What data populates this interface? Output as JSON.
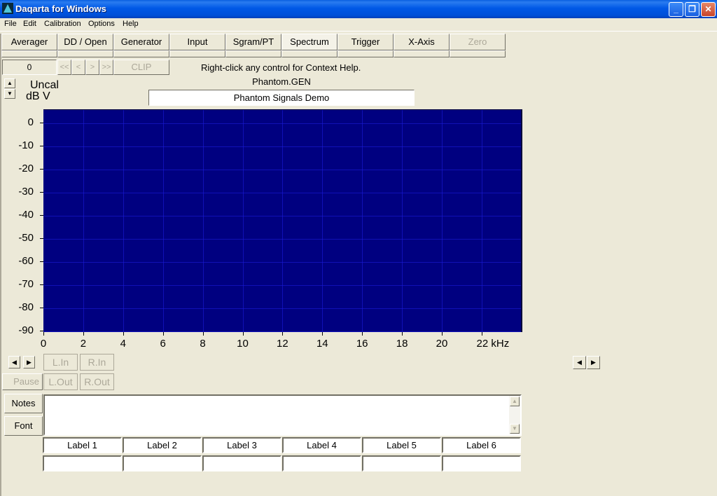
{
  "window": {
    "title": "Daqarta for Windows",
    "controls": {
      "minimize": "_",
      "restore": "❐",
      "close": "✕"
    }
  },
  "menu": [
    "File",
    "Edit",
    "Calibration",
    "Options",
    "Help"
  ],
  "tabs": [
    {
      "label": "Averager",
      "state": "normal"
    },
    {
      "label": "DD / Open",
      "state": "normal"
    },
    {
      "label": "Generator",
      "state": "normal"
    },
    {
      "label": "Input",
      "state": "normal"
    },
    {
      "label": "Sgram/PT",
      "state": "normal"
    },
    {
      "label": "Spectrum",
      "state": "active"
    },
    {
      "label": "Trigger",
      "state": "normal"
    },
    {
      "label": "X-Axis",
      "state": "normal"
    },
    {
      "label": "Zero",
      "state": "disabled"
    }
  ],
  "toolbar": {
    "frame_value": "0",
    "nav": [
      "<<",
      "<",
      ">",
      ">>"
    ],
    "clip_label": "CLIP",
    "help_text": "Right-click any control for Context Help."
  },
  "header": {
    "gen_file": "Phantom.GEN",
    "title_field": "Phantom Signals Demo",
    "cal_label": "Uncal",
    "unit_label": "dB V"
  },
  "colors": {
    "plot_background": "#000080",
    "grid": "#1a1ad8",
    "face": "#ece9d8"
  },
  "chart_data": {
    "type": "line",
    "title": "",
    "xlabel": "kHz",
    "ylabel": "dB V",
    "x_ticks": [
      "0",
      "2",
      "4",
      "6",
      "8",
      "10",
      "12",
      "14",
      "16",
      "18",
      "20",
      "22 kHz"
    ],
    "y_ticks": [
      "0",
      "-10",
      "-20",
      "-30",
      "-40",
      "-50",
      "-60",
      "-70",
      "-80",
      "-90"
    ],
    "xlim": [
      0,
      24
    ],
    "ylim": [
      -90,
      5
    ],
    "grid": true,
    "series": []
  },
  "controls": {
    "left_scroll": [
      "◀",
      "▶"
    ],
    "right_scroll": [
      "◀",
      "▶"
    ],
    "l_in": "L.In",
    "r_in": "R.In",
    "pause": "Pause",
    "l_out": "L.Out",
    "r_out": "R.Out"
  },
  "notes": {
    "notes_button": "Notes",
    "font_button": "Font",
    "text": ""
  },
  "labels": [
    "Label 1",
    "Label 2",
    "Label 3",
    "Label 4",
    "Label 5",
    "Label 6"
  ],
  "label_values": [
    "",
    "",
    "",
    "",
    "",
    ""
  ]
}
